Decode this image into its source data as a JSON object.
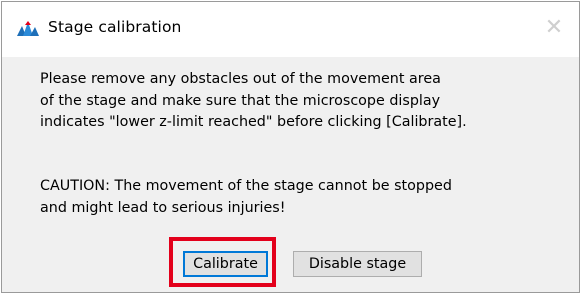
{
  "window": {
    "title": "Stage calibration",
    "close_glyph": "✕",
    "app_icon": "microscope-app-icon"
  },
  "message": {
    "lines_1": [
      "Please remove any obstacles out of the movement area",
      "of the stage and make sure that the microscope display",
      "indicates \"lower z-limit reached\" before clicking [Calibrate]."
    ],
    "lines_2": [
      "CAUTION: The movement of the stage cannot be stopped",
      "and might lead to serious injuries!"
    ]
  },
  "buttons": {
    "calibrate_label": "Calibrate",
    "disable_label": "Disable stage"
  },
  "colors": {
    "highlight": "#e3001b",
    "focus_border": "#0078d7",
    "icon_blue": "#1e6fb8"
  }
}
